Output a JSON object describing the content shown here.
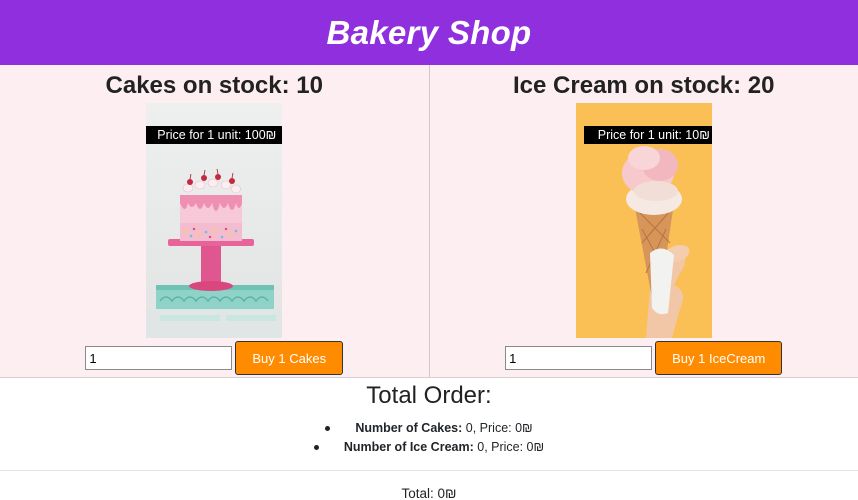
{
  "header": {
    "title": "Bakery Shop"
  },
  "products": [
    {
      "title": "Cakes on stock: 10",
      "price_label": "Price for 1 unit: 100₪",
      "qty_value": "1",
      "buy_label": "Buy 1 Cakes",
      "image": "cake-image"
    },
    {
      "title": "Ice Cream on stock: 20",
      "price_label": "Price for 1 unit: 10₪",
      "qty_value": "1",
      "buy_label": "Buy 1 IceCream",
      "image": "ice-cream-image"
    }
  ],
  "order": {
    "title": "Total Order:",
    "items": [
      {
        "label": "Number of Cakes:",
        "detail": " 0, Price: 0₪"
      },
      {
        "label": "Number of Ice Cream:",
        "detail": " 0, Price: 0₪"
      }
    ],
    "total": "Total: 0₪"
  },
  "colors": {
    "header_bg": "#8f2fdd",
    "products_bg": "#fdeef2",
    "button_bg": "#ff8c00"
  }
}
